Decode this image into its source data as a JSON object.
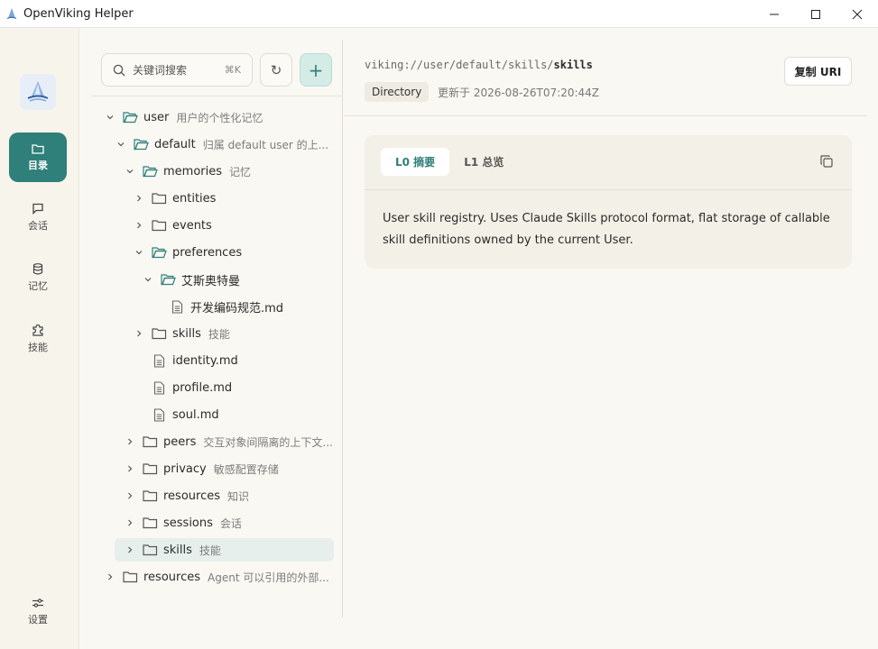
{
  "window": {
    "title": "OpenViking Helper"
  },
  "nav": [
    {
      "label": "目录",
      "icon": "folder-icon",
      "active": true
    },
    {
      "label": "会话",
      "icon": "chat-icon"
    },
    {
      "label": "记忆",
      "icon": "database-icon"
    },
    {
      "label": "技能",
      "icon": "puzzle-icon"
    }
  ],
  "settings_label": "设置",
  "search": {
    "placeholder": "关键词搜索",
    "shortcut": "⌘K"
  },
  "tree": [
    {
      "name": "user",
      "desc": "用户的个性化记忆",
      "type": "folder",
      "expanded": true
    },
    {
      "name": "default",
      "desc": "归属 default user 的上...",
      "type": "folder",
      "expanded": true
    },
    {
      "name": "memories",
      "desc": "记忆",
      "type": "folder",
      "expanded": true
    },
    {
      "name": "entities",
      "desc": "",
      "type": "folder",
      "expanded": false
    },
    {
      "name": "events",
      "desc": "",
      "type": "folder",
      "expanded": false
    },
    {
      "name": "preferences",
      "desc": "",
      "type": "folder",
      "expanded": true
    },
    {
      "name": "艾斯奥特曼",
      "desc": "",
      "type": "folder",
      "expanded": true
    },
    {
      "name": "开发编码规范.md",
      "desc": "",
      "type": "file"
    },
    {
      "name": "skills",
      "desc": "技能",
      "type": "folder",
      "expanded": false
    },
    {
      "name": "identity.md",
      "desc": "",
      "type": "file"
    },
    {
      "name": "profile.md",
      "desc": "",
      "type": "file"
    },
    {
      "name": "soul.md",
      "desc": "",
      "type": "file"
    },
    {
      "name": "peers",
      "desc": "交互对象间隔离的上下文...",
      "type": "folder",
      "expanded": false
    },
    {
      "name": "privacy",
      "desc": "敏感配置存储",
      "type": "folder",
      "expanded": false
    },
    {
      "name": "resources",
      "desc": "知识",
      "type": "folder",
      "expanded": false
    },
    {
      "name": "sessions",
      "desc": "会话",
      "type": "folder",
      "expanded": false
    },
    {
      "name": "skills",
      "desc": "技能",
      "type": "folder",
      "expanded": false,
      "selected": true
    },
    {
      "name": "resources",
      "desc": "Agent 可以引用的外部...",
      "type": "folder",
      "expanded": false
    }
  ],
  "detail": {
    "path_prefix": "viking://user/default/skills/",
    "path_last": "skills",
    "type": "Directory",
    "updated": "更新于 2026-08-26T07:20:44Z",
    "copy_uri_label": "复制 URI",
    "tabs": [
      "L0 摘要",
      "L1 总览"
    ],
    "summary": "User skill registry. Uses Claude Skills protocol format, flat storage of callable skill definitions owned by the current User."
  },
  "colors": {
    "accent": "#2f7f7a",
    "background": "#faf8f3"
  }
}
